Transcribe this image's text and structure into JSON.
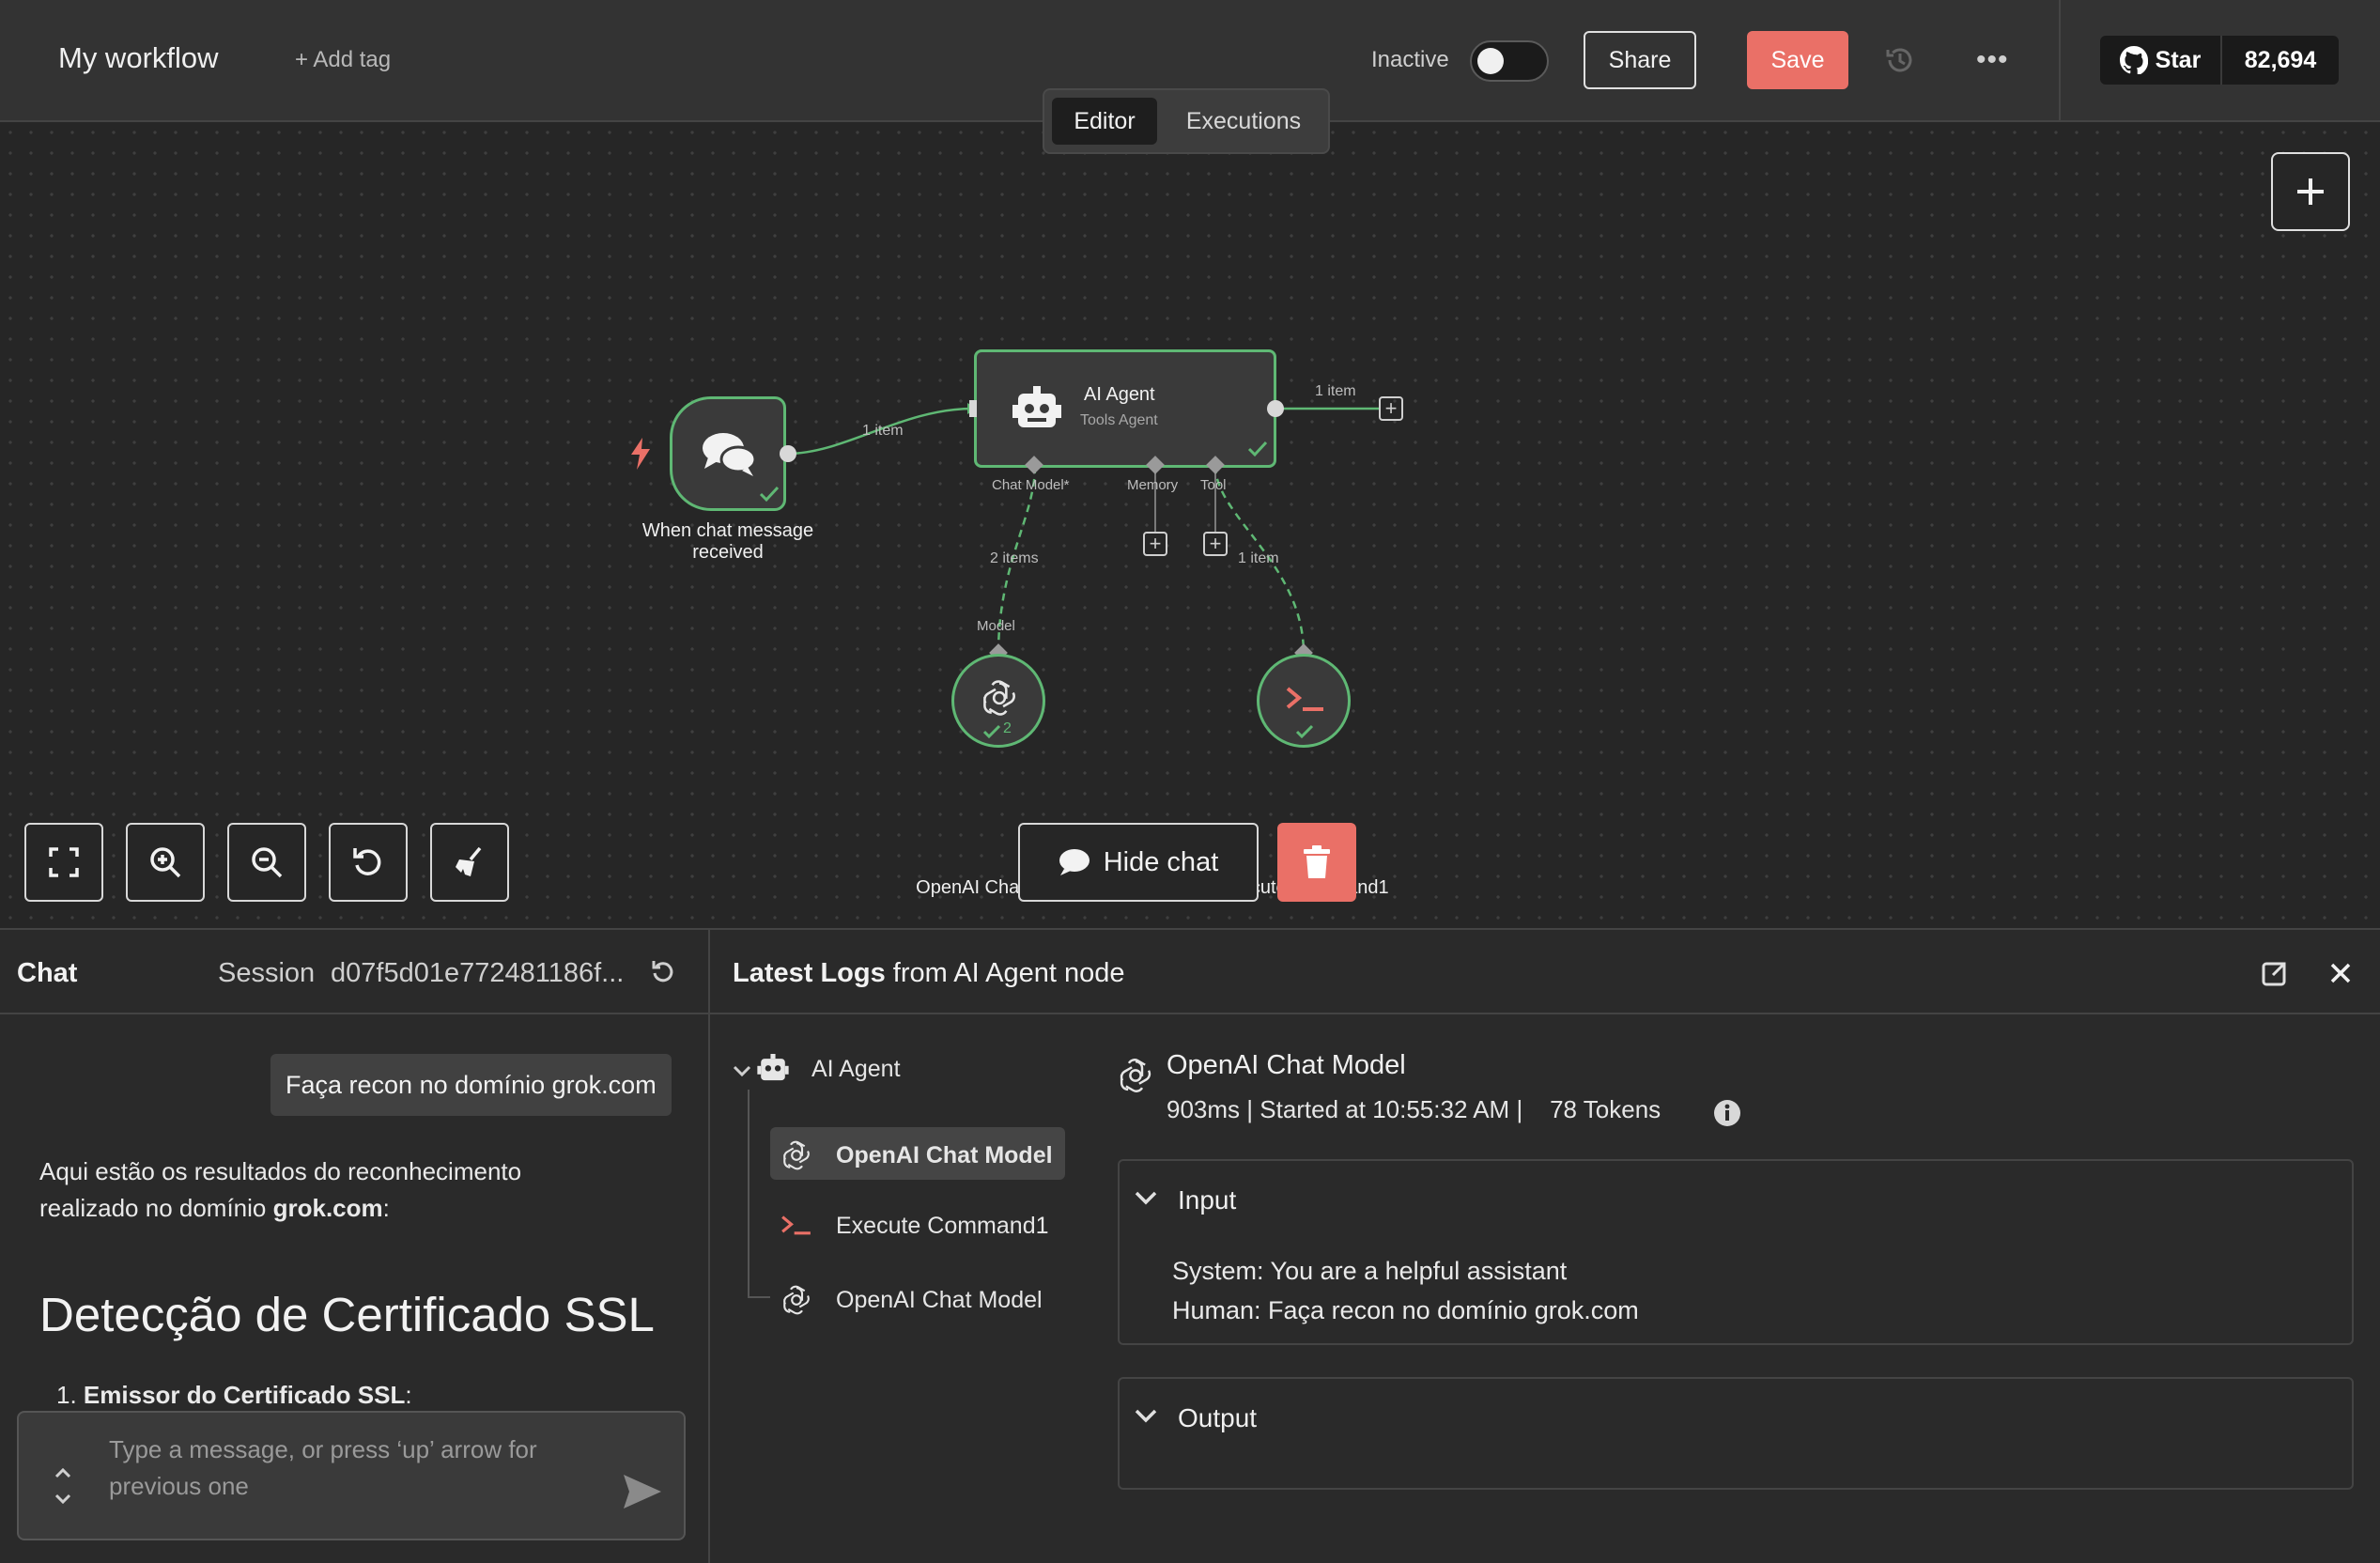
{
  "header": {
    "workflow_title": "My workflow",
    "add_tag": "+ Add tag",
    "status_label": "Inactive",
    "share": "Share",
    "save": "Save",
    "more": "•••",
    "github_star": "Star",
    "github_count": "82,694"
  },
  "tabs": {
    "editor": "Editor",
    "executions": "Executions"
  },
  "canvas": {
    "nodes": {
      "trigger": {
        "label_line1": "When chat message",
        "label_line2": "received"
      },
      "agent": {
        "title": "AI Agent",
        "subtitle": "Tools Agent"
      },
      "openai": {
        "label": "OpenAI Chat Model",
        "badge": "2"
      },
      "exec": {
        "label": "Execute Command1"
      }
    },
    "connections": {
      "trigger_to_agent": "1 item",
      "agent_out": "1 item",
      "chatmodel_items": "2 items",
      "tool_items": "1 item"
    },
    "ports": {
      "chat_model": "Chat Model*",
      "memory": "Memory",
      "tool": "Tool",
      "model": "Model"
    },
    "hide_chat": "Hide chat"
  },
  "chat": {
    "title": "Chat",
    "session_label": "Session",
    "session_id": "d07f5d01e772481186f...",
    "user_message": "Faça recon no domínio grok.com",
    "bot_intro_1": "Aqui estão os resultados do reconhecimento",
    "bot_intro_2": "realizado no domínio ",
    "bot_domain": "grok.com",
    "bot_intro_end": ":",
    "bot_heading": "Detecção de Certificado SSL",
    "bot_list_num": "1.",
    "bot_list_item": "Emissor do Certificado SSL",
    "bot_list_colon": ":",
    "input_placeholder": "Type a message, or press ‘up’ arrow for previous one"
  },
  "logs": {
    "title_bold": "Latest Logs",
    "title_rest": " from AI Agent node",
    "tree": [
      {
        "label": "AI Agent"
      },
      {
        "label": "OpenAI Chat Model"
      },
      {
        "label": "Execute Command1"
      },
      {
        "label": "OpenAI Chat Model"
      }
    ],
    "run_title": "OpenAI Chat Model",
    "run_duration": "903ms",
    "run_started": "Started at 10:55:32 AM",
    "run_tokens": "78 Tokens",
    "input_title": "Input",
    "input_system": "System: You are a helpful assistant",
    "input_human": "Human: Faça recon no domínio grok.com",
    "output_title": "Output"
  },
  "colors": {
    "accent": "#ea7067",
    "success": "#5fb874",
    "background": "#2b2b2b",
    "canvas": "#262626"
  }
}
